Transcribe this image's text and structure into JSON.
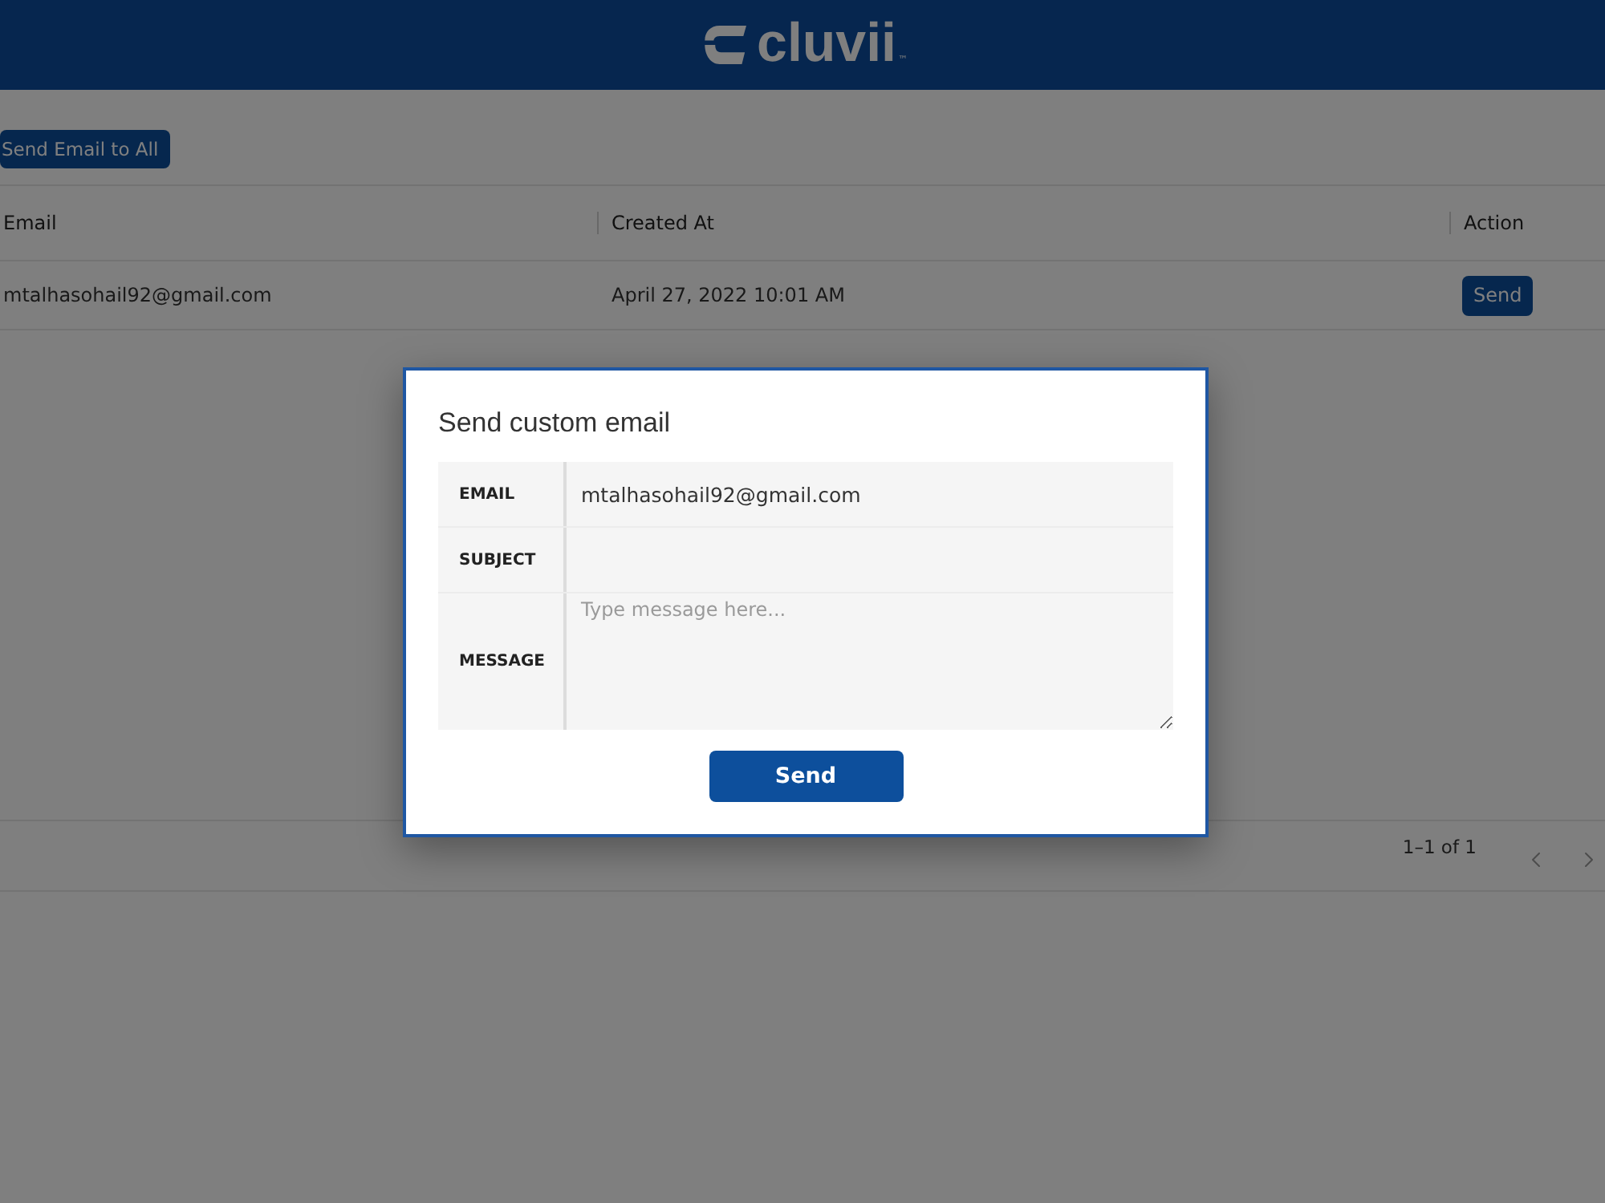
{
  "header": {
    "logo": "cluvii",
    "logo_mark": "™"
  },
  "toolbar": {
    "send_all_button": "Send Email to All"
  },
  "table": {
    "columns": [
      "Email",
      "Created At",
      "Action"
    ],
    "rows": [
      {
        "email": "mtalhasohail92@gmail.com",
        "created_at": "April 27, 2022 10:01 AM",
        "action": "Send"
      }
    ]
  },
  "pagination": {
    "range": "1–1 of 1"
  },
  "dialog": {
    "title": "Send custom email",
    "fields": [
      {
        "label": "EMAIL",
        "kind": "input",
        "value": "mtalhasohail92@gmail.com"
      },
      {
        "label": "SUBJECT",
        "kind": "input"
      },
      {
        "label": "MESSAGE",
        "kind": "textarea",
        "placeholder": "Type message here..."
      }
    ],
    "submit": "Send"
  }
}
